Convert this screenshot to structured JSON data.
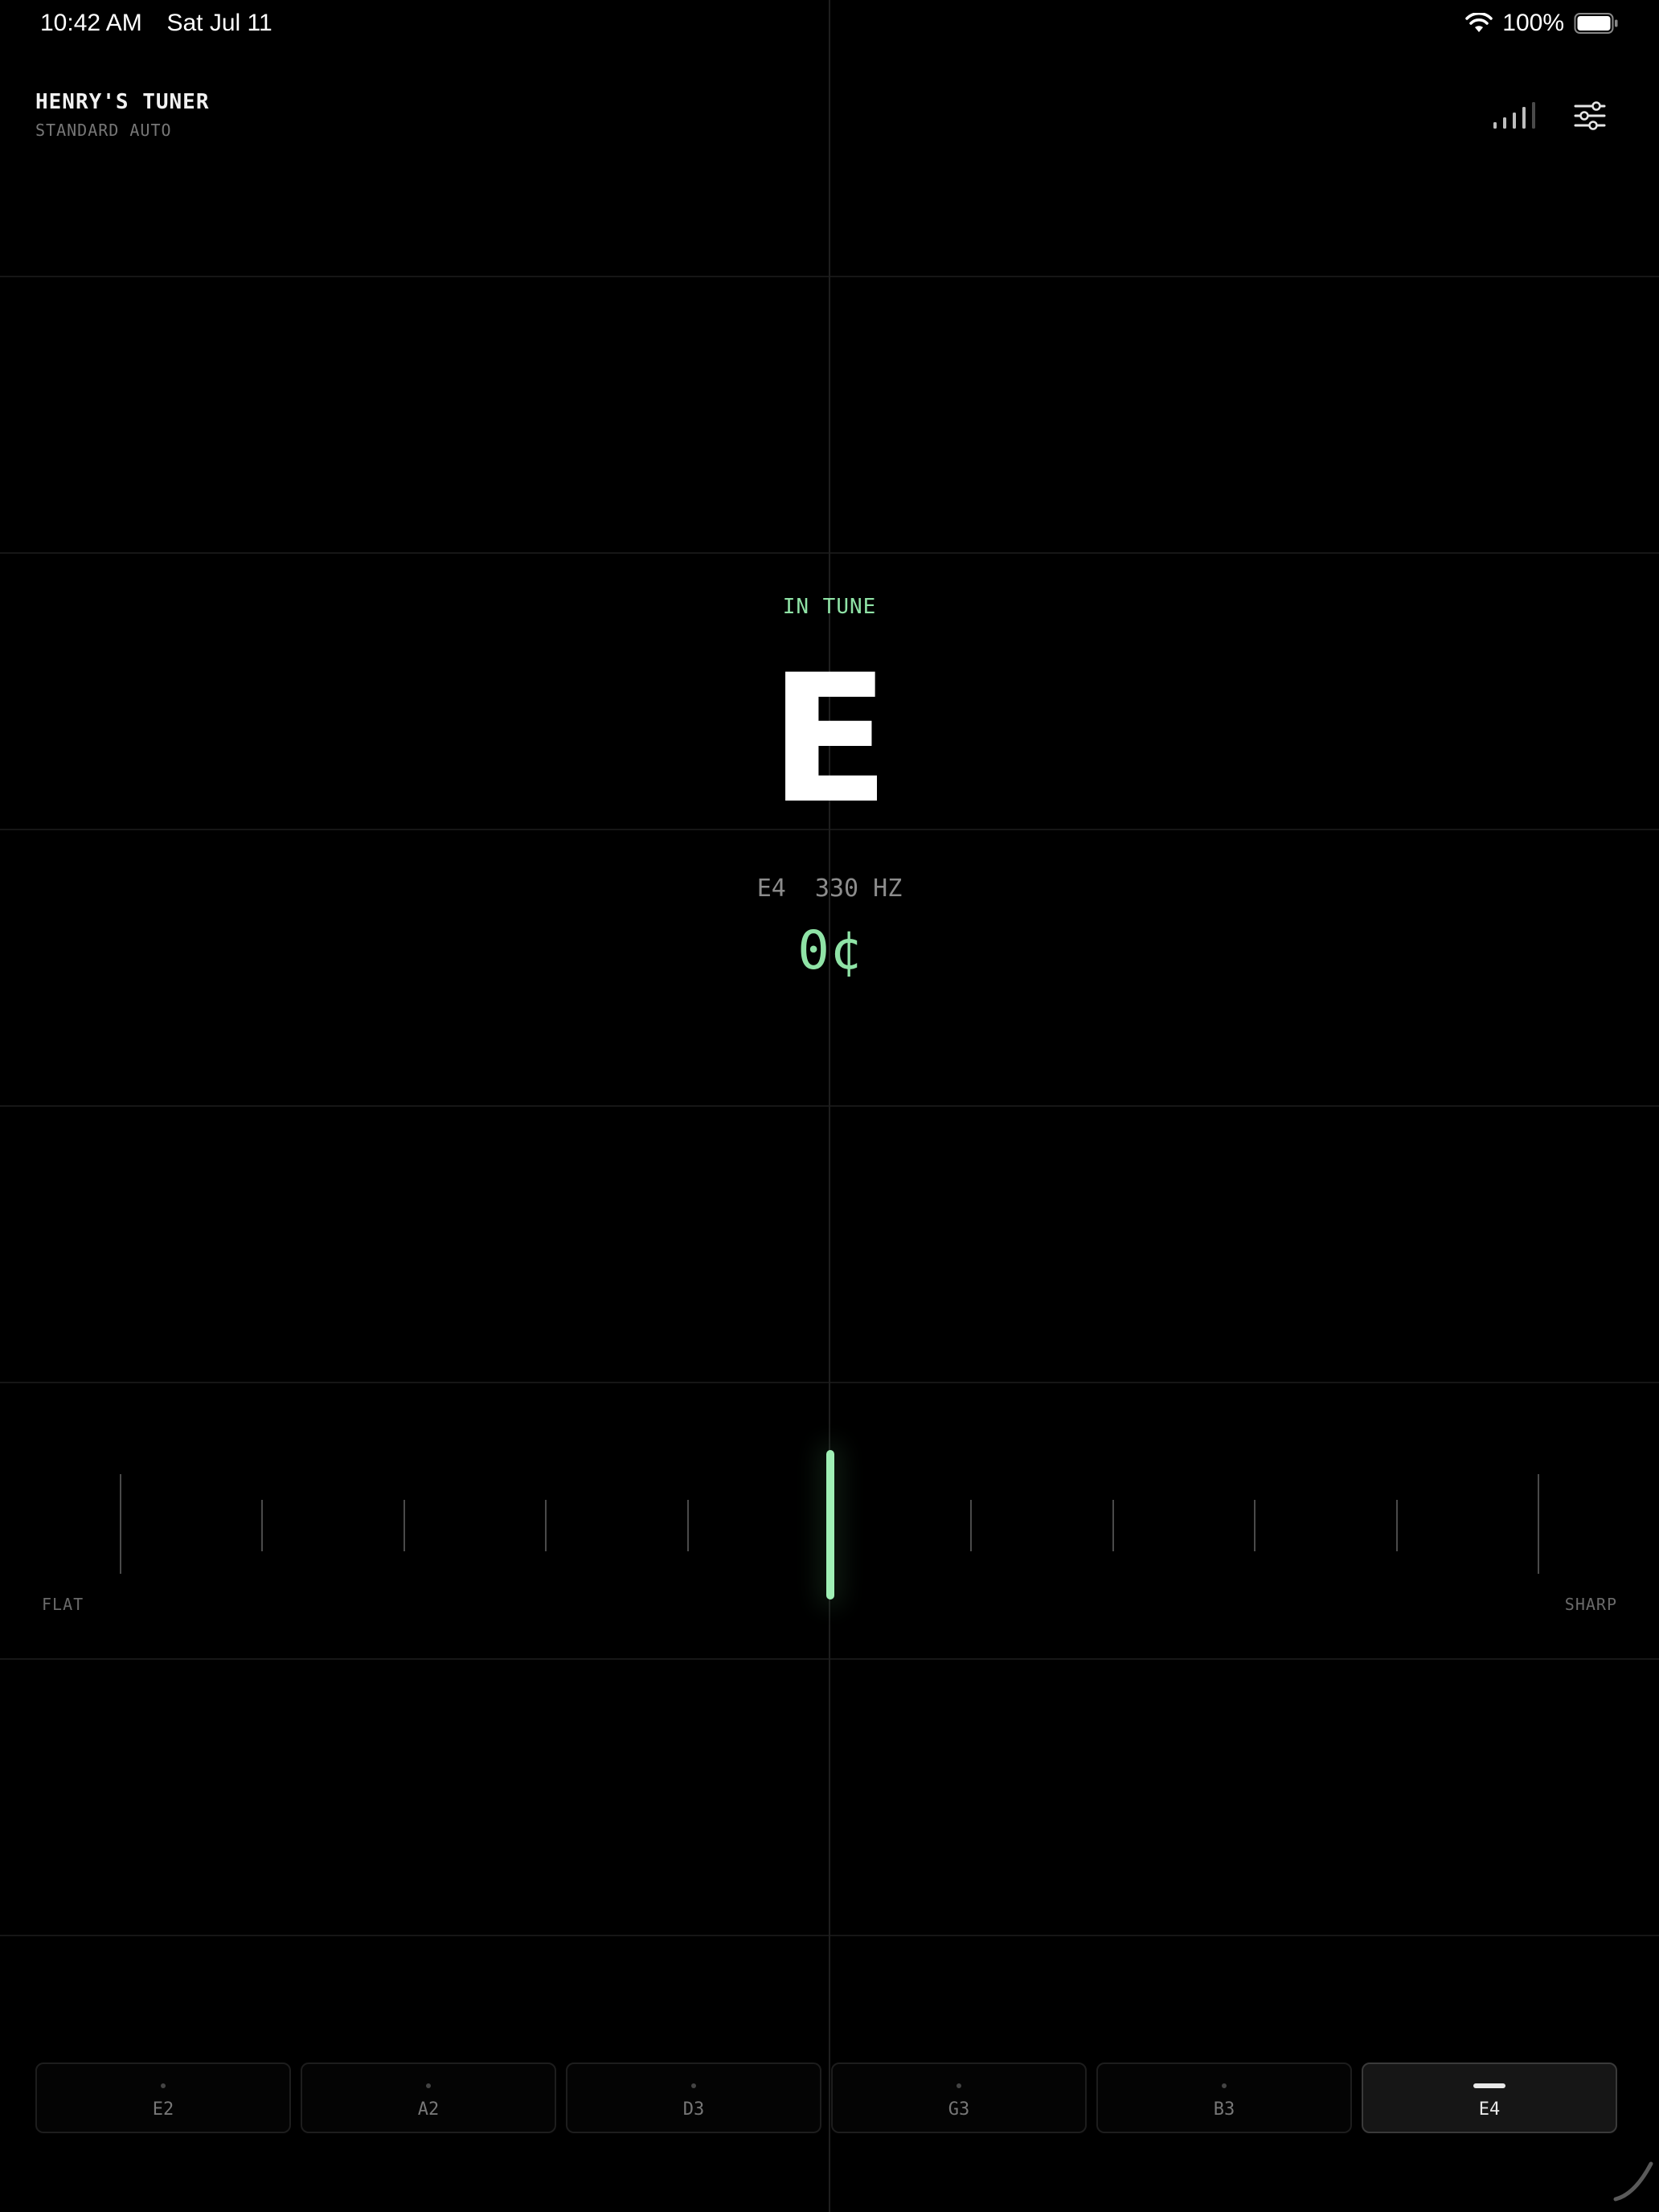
{
  "status_bar": {
    "time": "10:42 AM",
    "date": "Sat Jul 11",
    "battery_pct": "100%",
    "icons": [
      "wifi-icon",
      "battery-icon"
    ]
  },
  "header": {
    "title": "HENRY'S TUNER",
    "subtitle": "STANDARD AUTO",
    "icons": [
      "signal-level-icon",
      "settings-sliders-icon"
    ]
  },
  "readout": {
    "status": "IN TUNE",
    "note": "E",
    "detail": "E4  330 HZ",
    "cents": "0¢"
  },
  "meter": {
    "flat_label": "FLAT",
    "sharp_label": "SHARP",
    "cents_offset": 0
  },
  "strings": [
    {
      "label": "E2",
      "active": false
    },
    {
      "label": "A2",
      "active": false
    },
    {
      "label": "D3",
      "active": false
    },
    {
      "label": "G3",
      "active": false
    },
    {
      "label": "B3",
      "active": false
    },
    {
      "label": "E4",
      "active": true
    }
  ],
  "colors": {
    "accent": "#8fe3a6",
    "background": "#000000"
  }
}
